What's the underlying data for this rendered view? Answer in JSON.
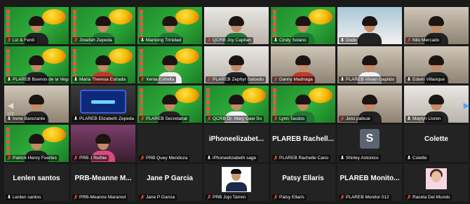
{
  "pager": {
    "text": "1/2"
  },
  "nav": {
    "prev_glyph": "◀",
    "next_glyph": "▶"
  },
  "colors": {
    "active_speaker": "#f5d90a",
    "background": "#1a1a1a",
    "label_bg": "rgba(0,0,0,0.55)",
    "mic_muted": "#e5443a"
  },
  "tiles": [
    {
      "name": "Liz & Ferdi",
      "muted": true,
      "kind": "video",
      "bg": "green",
      "shirt": "black",
      "icon": "person-video"
    },
    {
      "name": "Josefah Zepeda",
      "muted": true,
      "kind": "video",
      "bg": "green",
      "shirt": "green",
      "icon": "person-video"
    },
    {
      "name": "Mantong Trinidad",
      "muted": false,
      "kind": "video",
      "bg": "green",
      "shirt": "green",
      "active": true,
      "icon": "person-video"
    },
    {
      "name": "QCRB Joy Capitan",
      "muted": true,
      "kind": "video",
      "bg": "room2",
      "shirt": "green",
      "icon": "person-video"
    },
    {
      "name": "Cindy Solano",
      "muted": false,
      "kind": "video",
      "bg": "green",
      "shirt": "green",
      "icon": "person-video"
    },
    {
      "name": "Dodo",
      "muted": false,
      "kind": "video",
      "bg": "room3",
      "shirt": "black",
      "icon": "person-video"
    },
    {
      "name": "Nilo Mercado",
      "muted": true,
      "kind": "video",
      "bg": "room",
      "shirt": "black",
      "icon": "person-video"
    },
    {
      "name": "PLAREB Buenos de la Vega",
      "muted": false,
      "kind": "video",
      "bg": "green",
      "shirt": "black",
      "icon": "person-video"
    },
    {
      "name": "Maria Theresa Estrada",
      "muted": false,
      "kind": "video",
      "bg": "green",
      "shirt": "red",
      "icon": "person-video"
    },
    {
      "name": "Xenia Estrella",
      "muted": true,
      "kind": "video",
      "bg": "green",
      "shirt": "white",
      "icon": "person-video"
    },
    {
      "name": "PLAREB Zephyr Salcedo",
      "muted": true,
      "kind": "video",
      "bg": "room2",
      "shirt": "black",
      "icon": "person-video"
    },
    {
      "name": "Danny Madriaga",
      "muted": true,
      "kind": "video",
      "bg": "room",
      "shirt": "red",
      "icon": "person-video"
    },
    {
      "name": "PLAREB Vivian Gaplido",
      "muted": false,
      "kind": "video",
      "bg": "room",
      "shirt": "white",
      "icon": "person-video"
    },
    {
      "name": "Edwin Villanque",
      "muted": false,
      "kind": "video",
      "bg": "room",
      "shirt": "black",
      "icon": "person-video"
    },
    {
      "name": "Irene Barezante",
      "muted": false,
      "kind": "video",
      "bg": "room",
      "shirt": "black",
      "icon": "person-video"
    },
    {
      "name": "PLAREB Elizabeth Zepeda",
      "muted": false,
      "kind": "screen",
      "bg": "dark",
      "icon": "screen-share"
    },
    {
      "name": "PLAREB Secretariat",
      "muted": true,
      "kind": "video",
      "bg": "green",
      "shirt": "black",
      "icon": "person-video"
    },
    {
      "name": "QCRB Dr. Mary Gaw So",
      "muted": true,
      "kind": "video",
      "bg": "green",
      "shirt": "white",
      "icon": "person-video"
    },
    {
      "name": "Lynn Tacdos",
      "muted": true,
      "kind": "video",
      "bg": "green",
      "shirt": "green",
      "icon": "person-video"
    },
    {
      "name": "Jess pabual",
      "muted": true,
      "kind": "video",
      "bg": "room",
      "shirt": "black",
      "icon": "person-video"
    },
    {
      "name": "Maylyn Lloren",
      "muted": false,
      "kind": "video",
      "bg": "room2",
      "shirt": "black",
      "icon": "person-video"
    },
    {
      "name": "Patrick Henry Fuertes",
      "muted": true,
      "kind": "video",
      "bg": "green",
      "shirt": "black",
      "icon": "person-video"
    },
    {
      "name": "PRB J Ruthie",
      "muted": true,
      "kind": "video",
      "bg": "purple",
      "shirt": "pink",
      "icon": "person-video"
    },
    {
      "name": "PRB Quey Mendoza",
      "muted": true,
      "kind": "name",
      "display": "",
      "icon": "none"
    },
    {
      "name": "iPhoneelizabeth sage",
      "muted": false,
      "kind": "name",
      "display": "iPhoneelizabet...",
      "icon": "none"
    },
    {
      "name": "PLAREB Rachelle Cano",
      "muted": true,
      "kind": "name",
      "display": "PLAREB Rachell...",
      "icon": "none"
    },
    {
      "name": "Shirley Antonico",
      "muted": false,
      "kind": "avatar",
      "initial": "S",
      "icon": "initial-avatar"
    },
    {
      "name": "Colette",
      "muted": false,
      "kind": "name",
      "display": "Colette",
      "icon": "none"
    },
    {
      "name": "Lenlen santos",
      "muted": false,
      "kind": "name",
      "display": "Lenlen santos",
      "icon": "none"
    },
    {
      "name": "PRB-Meanne Maramot",
      "muted": true,
      "kind": "name",
      "display": "PRB-Meanne M...",
      "icon": "none"
    },
    {
      "name": "Jane P Garcia",
      "muted": true,
      "kind": "name",
      "display": "Jane P Garcia",
      "icon": "none"
    },
    {
      "name": "PRB Jojo Tarren",
      "muted": true,
      "kind": "photo",
      "icon": "profile-photo"
    },
    {
      "name": "Patsy Ellaris",
      "muted": true,
      "kind": "name",
      "display": "Patsy Ellaris",
      "icon": "none"
    },
    {
      "name": "PLAREB Monitor 012",
      "muted": true,
      "kind": "name",
      "display": "PLAREB Monito...",
      "icon": "none"
    },
    {
      "name": "Racela Del Mundo",
      "muted": true,
      "kind": "photo2",
      "icon": "profile-photo"
    }
  ]
}
